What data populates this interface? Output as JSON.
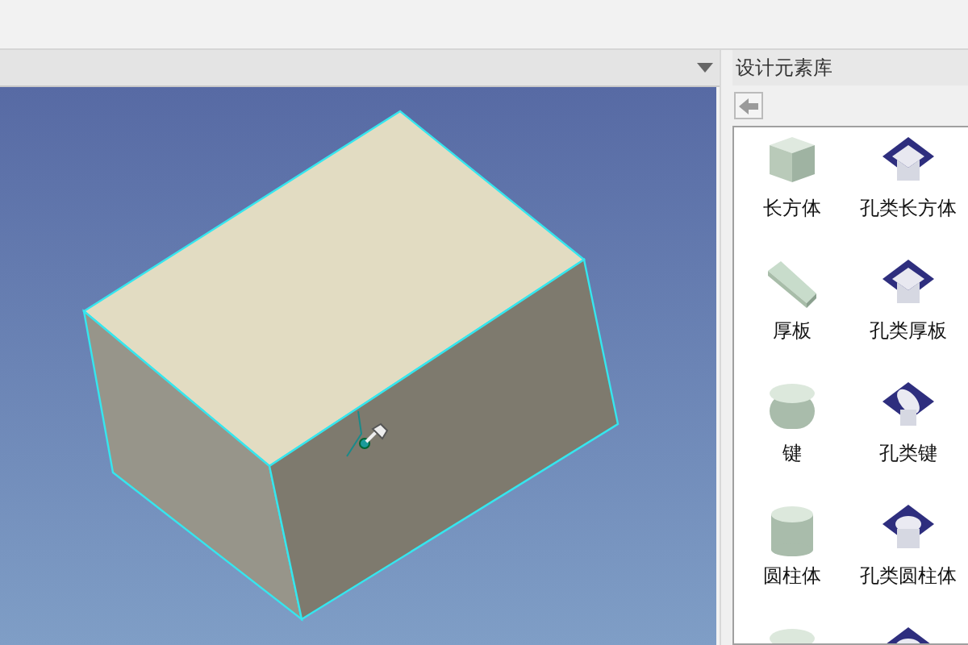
{
  "library_panel": {
    "title": "设计元素库",
    "items": [
      {
        "label": "长方体",
        "kind": "box"
      },
      {
        "label": "孔类长方体",
        "kind": "hole-box"
      },
      {
        "label": "厚板",
        "kind": "plate"
      },
      {
        "label": "孔类厚板",
        "kind": "hole-plate"
      },
      {
        "label": "键",
        "kind": "key"
      },
      {
        "label": "孔类键",
        "kind": "hole-key"
      },
      {
        "label": "圆柱体",
        "kind": "cylinder"
      },
      {
        "label": "孔类圆柱体",
        "kind": "hole-cylinder"
      },
      {
        "kind": "key"
      },
      {
        "kind": "hole-cylinder"
      }
    ]
  }
}
